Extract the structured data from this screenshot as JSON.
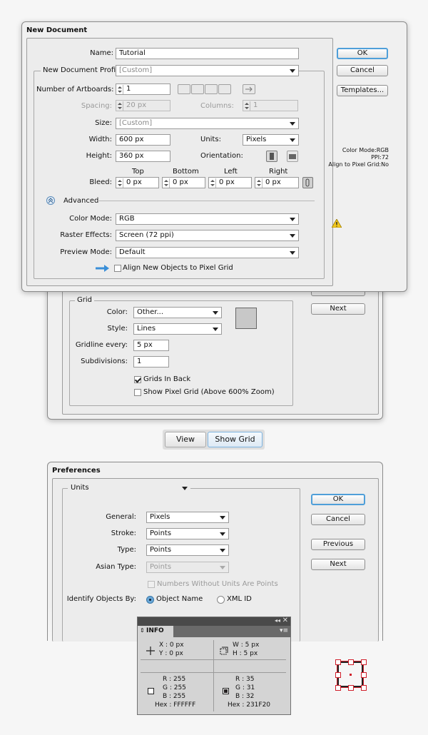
{
  "new_document": {
    "title": "New Document",
    "name_label": "Name:",
    "name_value": "Tutorial",
    "profile_label": "New Document Profile:",
    "profile_value": "[Custom]",
    "artboards_label": "Number of Artboards:",
    "artboards_value": "1",
    "spacing_label": "Spacing:",
    "spacing_value": "20 px",
    "columns_label": "Columns:",
    "columns_value": "1",
    "size_label": "Size:",
    "size_value": "[Custom]",
    "width_label": "Width:",
    "width_value": "600 px",
    "units_label": "Units:",
    "units_value": "Pixels",
    "height_label": "Height:",
    "height_value": "360 px",
    "orientation_label": "Orientation:",
    "bleed_label": "Bleed:",
    "bleed_headers": [
      "Top",
      "Bottom",
      "Left",
      "Right"
    ],
    "bleed_values": [
      "0 px",
      "0 px",
      "0 px",
      "0 px"
    ],
    "advanced_label": "Advanced",
    "color_mode_label": "Color Mode:",
    "color_mode_value": "RGB",
    "raster_label": "Raster Effects:",
    "raster_value": "Screen (72 ppi)",
    "preview_label": "Preview Mode:",
    "preview_value": "Default",
    "align_label": "Align New Objects to Pixel Grid",
    "ok": "OK",
    "cancel": "Cancel",
    "templates": "Templates...",
    "summary": [
      "Color Mode:RGB",
      "PPI:72",
      "Align to Pixel Grid:No"
    ]
  },
  "grid_prefs": {
    "group_label": "Grid",
    "color_label": "Color:",
    "color_value": "Other...",
    "style_label": "Style:",
    "style_value": "Lines",
    "gridline_label": "Gridline every:",
    "gridline_value": "5 px",
    "subdiv_label": "Subdivisions:",
    "subdiv_value": "1",
    "grids_in_back": "Grids In Back",
    "show_pixel_grid": "Show Pixel Grid (Above 600% Zoom)",
    "next": "Next",
    "swatch_color": "#c8c8c8"
  },
  "menu_path": {
    "view": "View",
    "show_grid": "Show Grid"
  },
  "preferences": {
    "title": "Preferences",
    "section": "Units",
    "general_label": "General:",
    "general_value": "Pixels",
    "stroke_label": "Stroke:",
    "stroke_value": "Points",
    "type_label": "Type:",
    "type_value": "Points",
    "asian_label": "Asian Type:",
    "asian_value": "Points",
    "numbers_label": "Numbers Without Units Are Points",
    "identify_label": "Identify Objects By:",
    "object_name": "Object Name",
    "xml_id": "XML ID",
    "ok": "OK",
    "cancel": "Cancel",
    "previous": "Previous",
    "next": "Next"
  },
  "info_panel": {
    "tab": "INFO",
    "x": "X : 0 px",
    "y": "Y : 0 px",
    "w": "W : 5 px",
    "h": "H : 5 px",
    "left_r": "R : 255",
    "left_g": "G : 255",
    "left_b": "B : 255",
    "left_hex": "Hex : FFFFFF",
    "right_r": "R : 35",
    "right_g": "G : 31",
    "right_b": "B : 32",
    "right_hex": "Hex : 231F20"
  },
  "colors": {
    "accent": "#4f9fd9",
    "selection": "#d01e2a"
  }
}
